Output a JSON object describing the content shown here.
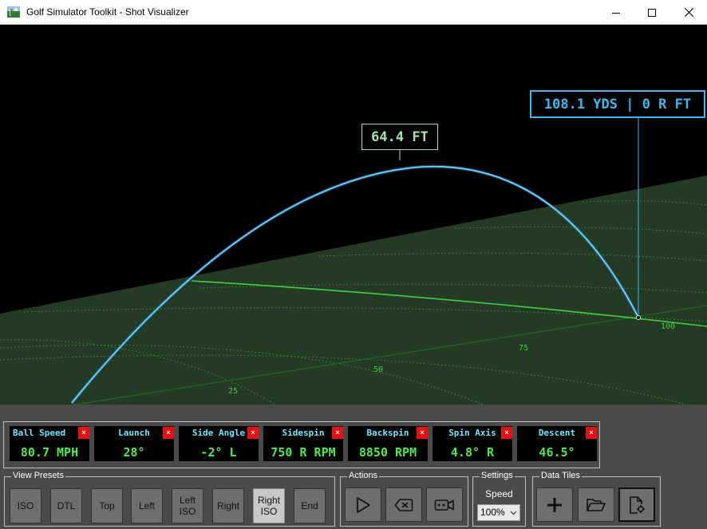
{
  "window": {
    "title": "Golf Simulator Toolkit - Shot Visualizer"
  },
  "viewport": {
    "apex_callout": "64.4 FT",
    "carry_callout": "108.1 YDS | 0 R FT",
    "distance_markers": [
      "25",
      "50",
      "75",
      "100"
    ],
    "colors": {
      "trajectory": "#3fb8f0",
      "apex": "#a8e0a8",
      "ground": "#253a25",
      "grid": "#3ecf3e"
    }
  },
  "data_tiles": [
    {
      "label": "Ball Speed",
      "value": "80.7 MPH"
    },
    {
      "label": "Launch",
      "value": "28°"
    },
    {
      "label": "Side Angle",
      "value": "-2° L"
    },
    {
      "label": "Sidespin",
      "value": "750 R RPM"
    },
    {
      "label": "Backspin",
      "value": "8850 RPM"
    },
    {
      "label": "Spin Axis",
      "value": "4.8° R"
    },
    {
      "label": "Descent",
      "value": "46.5°"
    }
  ],
  "tile_close_glyph": "×",
  "view_presets": {
    "title": "View Presets",
    "buttons": [
      "ISO",
      "DTL",
      "Top",
      "Left",
      "Left ISO",
      "Right",
      "Right ISO",
      "End"
    ],
    "active": "Right ISO"
  },
  "actions": {
    "title": "Actions",
    "buttons": [
      "play-icon",
      "clear-icon",
      "camera-icon"
    ]
  },
  "settings": {
    "title": "Settings",
    "speed_label": "Speed",
    "speed_value": "100%"
  },
  "data_tiles_group": {
    "title": "Data Tiles",
    "buttons": [
      "add-icon",
      "folder-open-icon",
      "file-settings-icon"
    ]
  }
}
